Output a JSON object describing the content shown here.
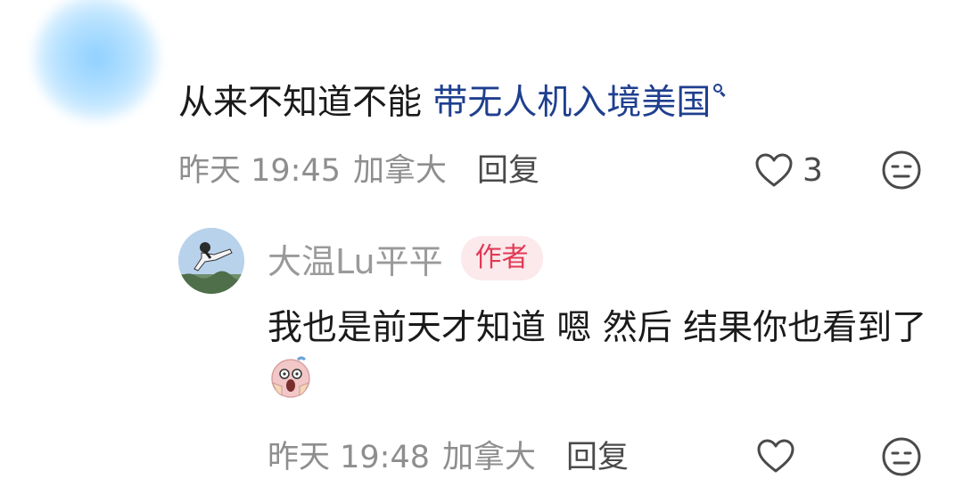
{
  "parent_comment": {
    "text": "从来不知道不能 ",
    "link_text": "带无人机入境美国",
    "time": "昨天 19:45",
    "location": "加拿大",
    "reply_label": "回复",
    "like_count": "3"
  },
  "reply": {
    "username": "大温Lu平平",
    "badge": "作者",
    "text": "我也是前天才知道 嗯 然后 结果你也看到了",
    "emoji": "scream-emoji",
    "time": "昨天 19:48",
    "location": "加拿大",
    "reply_label": "回复"
  },
  "colors": {
    "link": "#1f3f8f",
    "badge_text": "#e03a55",
    "badge_bg": "#fbe9ec",
    "meta": "#8e8e8e"
  }
}
